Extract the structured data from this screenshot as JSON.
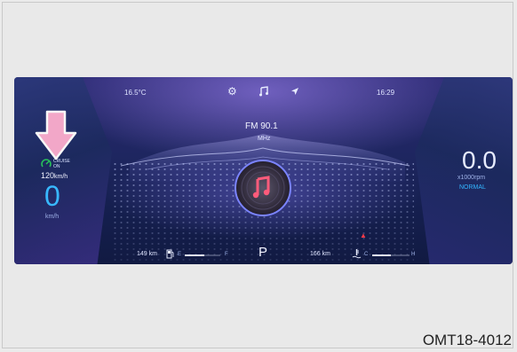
{
  "cluster": {
    "temperature": "16.5°C",
    "time": "16:29",
    "radio": {
      "station": "FM 90.1",
      "band": "MHz"
    },
    "cruise": {
      "label": "CRUISE",
      "state": "ON",
      "set_speed": "120",
      "set_unit": "km/h"
    },
    "speed": {
      "value": "0",
      "unit": "km/h"
    },
    "rpm": {
      "value": "0.0",
      "unit": "x1000rpm",
      "mode": "NORMAL"
    },
    "fuel": {
      "range": "149",
      "unit": "km",
      "empty": "E",
      "full": "F",
      "level": 0.55
    },
    "gear": "P",
    "temp_gauge": {
      "range": "166",
      "unit": "km",
      "cold": "C",
      "hot": "H",
      "level": 0.5
    },
    "top_icons": [
      "settings-icon",
      "music-icon",
      "navigation-icon"
    ],
    "colors": {
      "cruise_green": "#27c35a",
      "accent_cyan": "#33b6ff",
      "arrow_pink": "#f2a7c8",
      "record_red": "#ff4b6e"
    }
  },
  "figure_code": "OMT18-4012"
}
